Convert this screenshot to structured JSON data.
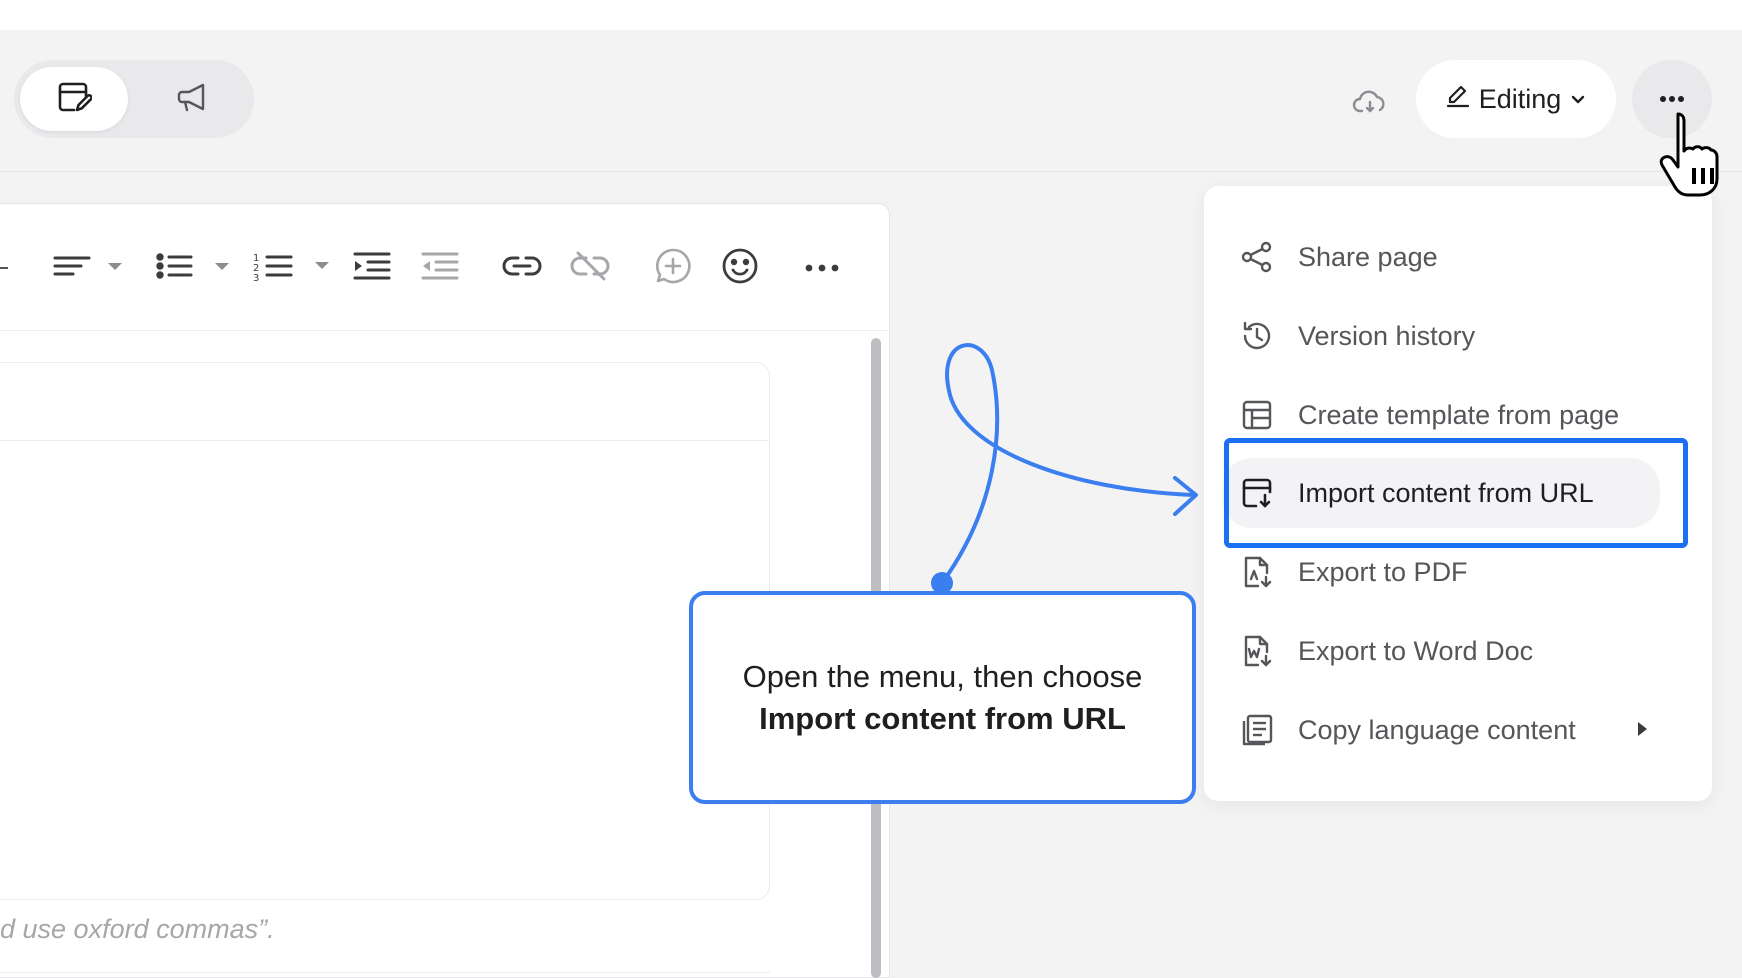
{
  "header": {
    "mode_edit_icon": "edit-page-icon",
    "mode_announce_icon": "megaphone-icon",
    "sync_icon": "cloud-sync-icon",
    "editing_label": "Editing",
    "more_icon": "ellipsis-icon"
  },
  "toolbar": {
    "items": [
      "align-icon",
      "bullet-list-icon",
      "numbered-list-icon",
      "indent-icon",
      "outdent-icon",
      "link-icon",
      "unlink-icon",
      "add-comment-icon",
      "emoji-icon",
      "more-icon"
    ]
  },
  "editor": {
    "placeholder_text": "d use oxford commas”."
  },
  "menu": {
    "items": [
      {
        "label": "Share page",
        "icon": "share-icon"
      },
      {
        "label": "Version history",
        "icon": "history-icon"
      },
      {
        "label": "Create template from page",
        "icon": "template-icon"
      },
      {
        "label": "Import content from URL",
        "icon": "import-icon"
      },
      {
        "label": "Export to PDF",
        "icon": "pdf-export-icon"
      },
      {
        "label": "Export to Word Doc",
        "icon": "word-export-icon"
      },
      {
        "label": "Copy language content",
        "icon": "copy-language-icon"
      }
    ]
  },
  "callout": {
    "text_prefix": "Open the menu, then choose ",
    "text_bold": "Import content from URL"
  },
  "colors": {
    "accent": "#1a6ff2",
    "callout_border": "#3a7ef0",
    "background": "#f3f3f4"
  }
}
